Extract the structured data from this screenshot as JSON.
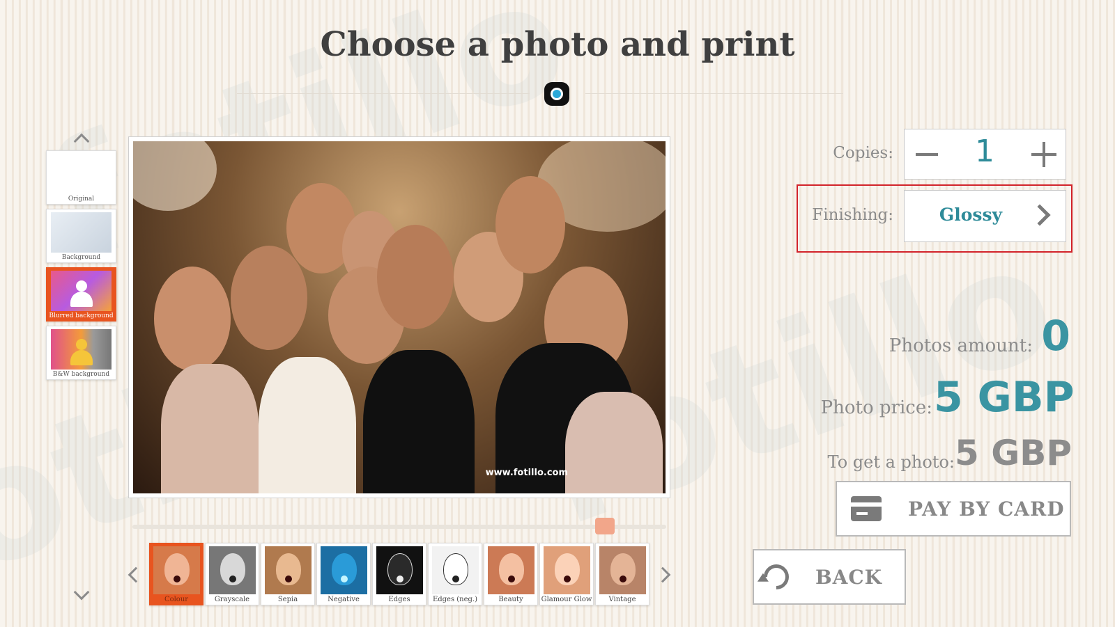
{
  "title": "Choose a photo and print",
  "logo": {
    "icon": "camera-logo-icon"
  },
  "effects": {
    "up_icon": "chevron-up-icon",
    "down_icon": "chevron-down-icon",
    "items": [
      {
        "label": "Original",
        "active": false
      },
      {
        "label": "Background",
        "active": false
      },
      {
        "label": "Blurred background",
        "active": true
      },
      {
        "label": "B&W background",
        "active": false
      }
    ]
  },
  "photo": {
    "watermark": "www.fotillo.com"
  },
  "filters": {
    "prev_icon": "chevron-left-icon",
    "next_icon": "chevron-right-icon",
    "items": [
      {
        "label": "Colour",
        "active": true
      },
      {
        "label": "Grayscale",
        "active": false
      },
      {
        "label": "Sepia",
        "active": false
      },
      {
        "label": "Negative",
        "active": false
      },
      {
        "label": "Edges",
        "active": false
      },
      {
        "label": "Edges (neg.)",
        "active": false
      },
      {
        "label": "Beauty",
        "active": false
      },
      {
        "label": "Glamour Glow",
        "active": false
      },
      {
        "label": "Vintage",
        "active": false
      }
    ]
  },
  "copies": {
    "label": "Copies:",
    "value": "1"
  },
  "finishing": {
    "label": "Finishing:",
    "value": "Glossy"
  },
  "summary": {
    "photos_amount_label": "Photos amount:",
    "photos_amount_value": "0",
    "photo_price_label": "Photo price:",
    "photo_price_value": "5 GBP",
    "to_get_label": "To get a photo:",
    "to_get_value": "5 GBP"
  },
  "buttons": {
    "pay": "PAY BY CARD",
    "back": "BACK"
  },
  "colors": {
    "accent": "#e8541f",
    "teal": "#3a94a2",
    "highlight": "#d2232a"
  }
}
